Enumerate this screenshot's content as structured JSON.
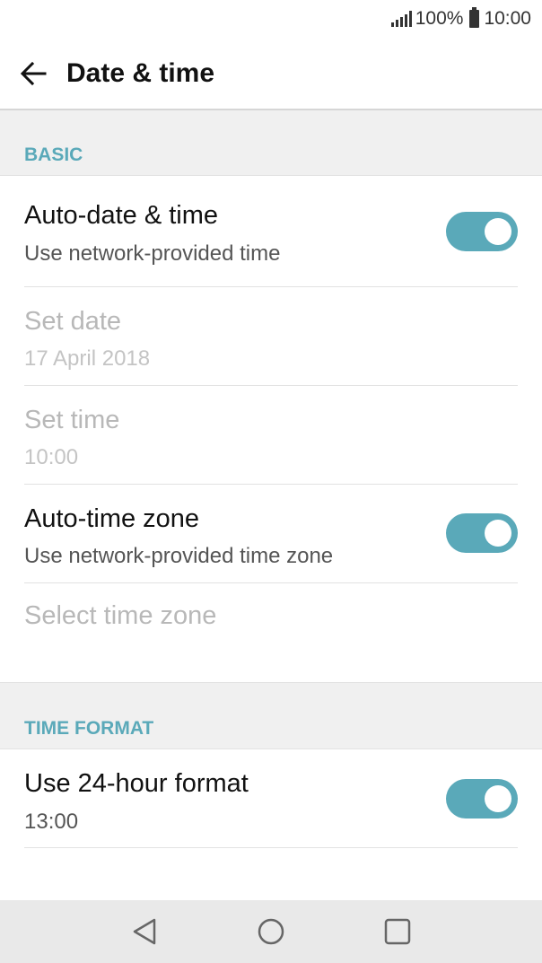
{
  "status_bar": {
    "battery": "100%",
    "time": "10:00"
  },
  "app_bar": {
    "title": "Date & time"
  },
  "sections": {
    "basic": {
      "header": "BASIC"
    },
    "time_format": {
      "header": "TIME FORMAT"
    }
  },
  "settings": {
    "auto_date_time": {
      "title": "Auto-date & time",
      "summary": "Use network-provided time",
      "enabled": true
    },
    "set_date": {
      "title": "Set date",
      "summary": "17 April 2018"
    },
    "set_time": {
      "title": "Set time",
      "summary": "10:00"
    },
    "auto_time_zone": {
      "title": "Auto-time zone",
      "summary": "Use network-provided time zone",
      "enabled": true
    },
    "select_time_zone": {
      "title": "Select time zone"
    },
    "use_24_hour": {
      "title": "Use 24-hour format",
      "summary": "13:00",
      "enabled": true
    }
  },
  "colors": {
    "accent": "#5aa9b9",
    "section_bg": "#f0f0f0",
    "nav_bg": "#e9e9e9"
  },
  "nav_bar": {
    "icons": [
      "back-triangle-icon",
      "home-circle-icon",
      "recents-square-icon"
    ]
  }
}
